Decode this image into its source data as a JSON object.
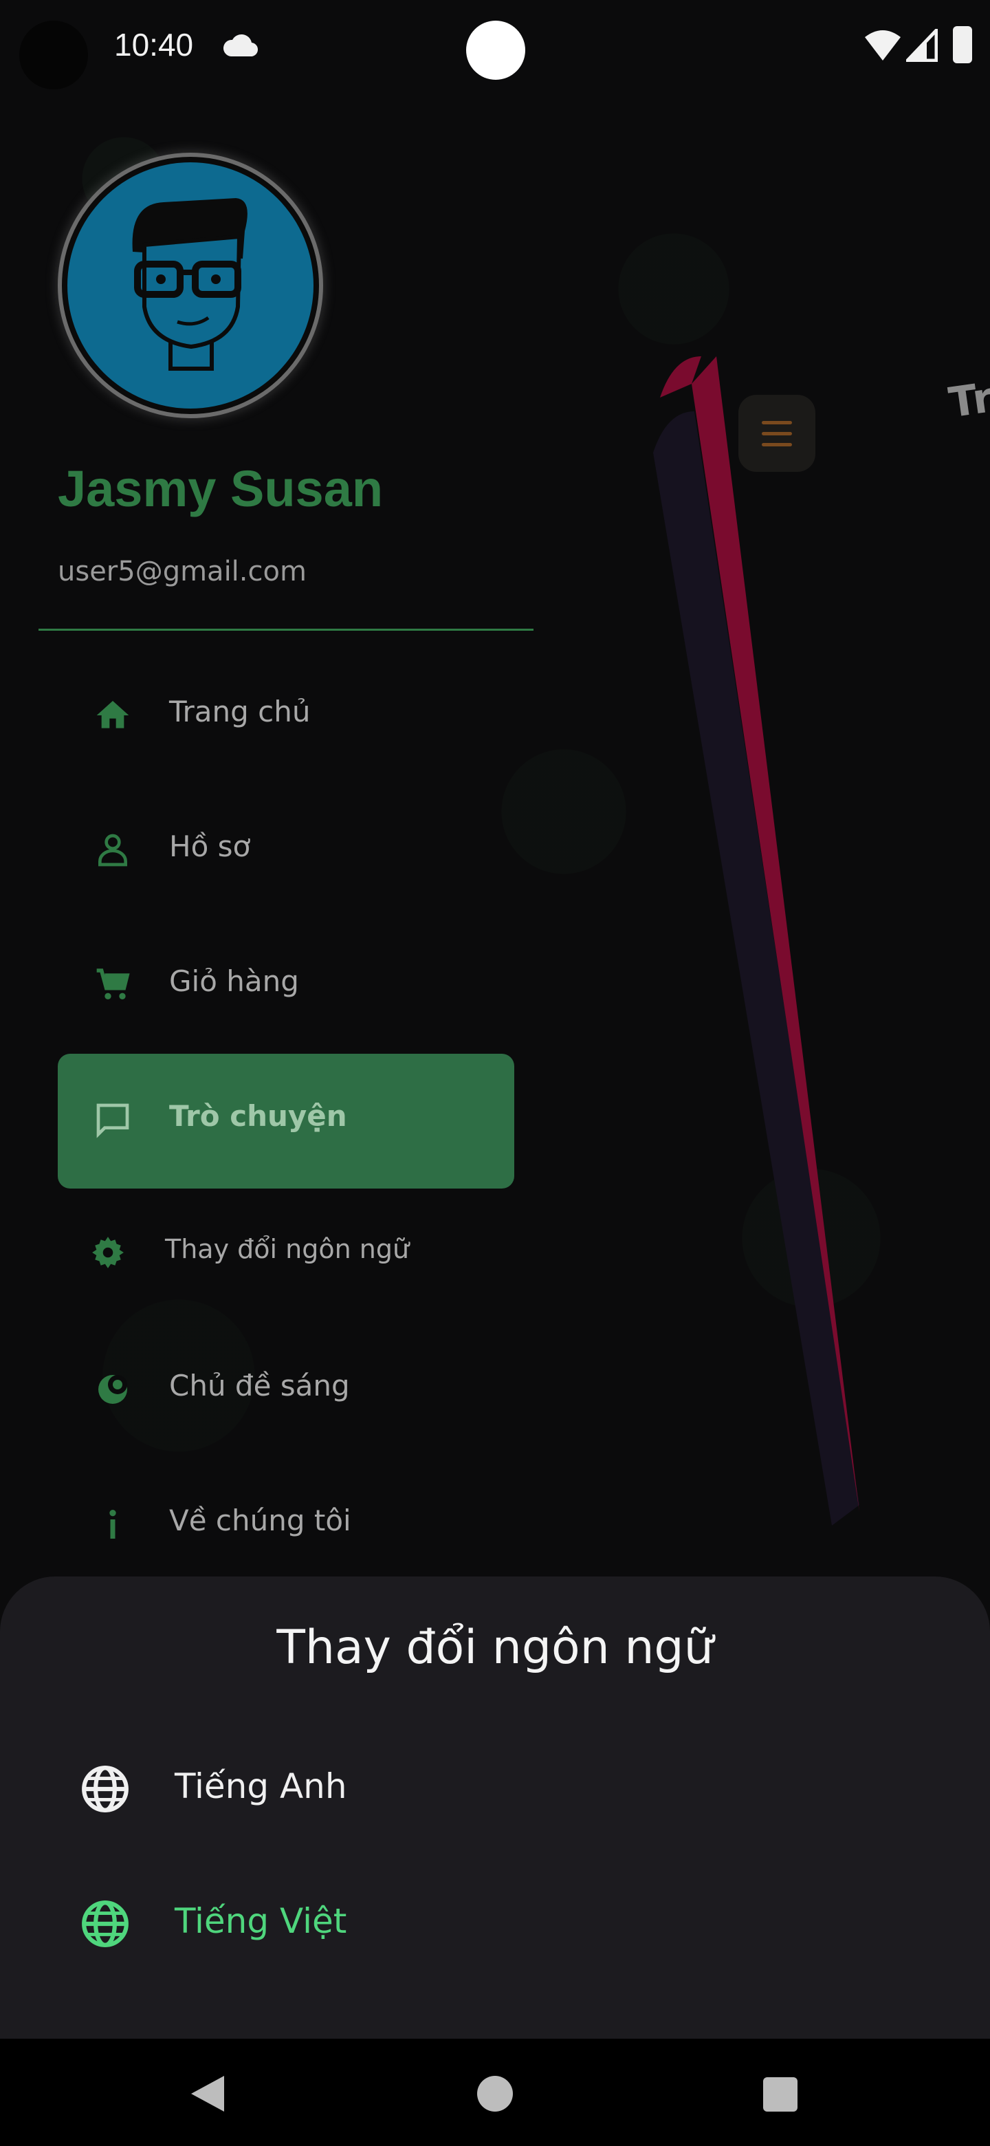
{
  "status_bar": {
    "time": "10:40",
    "icons": [
      "cloud-icon",
      "wifi-icon",
      "signal-icon",
      "battery-icon"
    ]
  },
  "profile": {
    "name": "Jasmy Susan",
    "email": "user5@gmail.com"
  },
  "menu": {
    "items": [
      {
        "label": "Trang chủ",
        "icon": "home-icon"
      },
      {
        "label": "Hồ sơ",
        "icon": "person-icon"
      },
      {
        "label": "Giỏ hàng",
        "icon": "cart-icon"
      },
      {
        "label": "Trò chuyện",
        "icon": "chat-icon",
        "active": true
      },
      {
        "label": "Thay đổi ngôn ngữ",
        "icon": "gear-icon"
      },
      {
        "label": "Chủ đề sáng",
        "icon": "theme-icon"
      },
      {
        "label": "Về chúng tôi",
        "icon": "info-icon"
      }
    ]
  },
  "preview": {
    "title_fragment": "Trò"
  },
  "language_sheet": {
    "title": "Thay đổi ngôn ngữ",
    "options": [
      {
        "label": "Tiếng Anh",
        "icon": "globe-icon",
        "selected": false
      },
      {
        "label": "Tiếng Việt",
        "icon": "globe-icon",
        "selected": true
      }
    ]
  },
  "colors": {
    "accent_green": "#2f7a44",
    "selected_green": "#4fd67d",
    "panel_pink": "#7a0b2e",
    "panel_dark": "#16121f",
    "sheet_bg": "#1c1b1f"
  }
}
